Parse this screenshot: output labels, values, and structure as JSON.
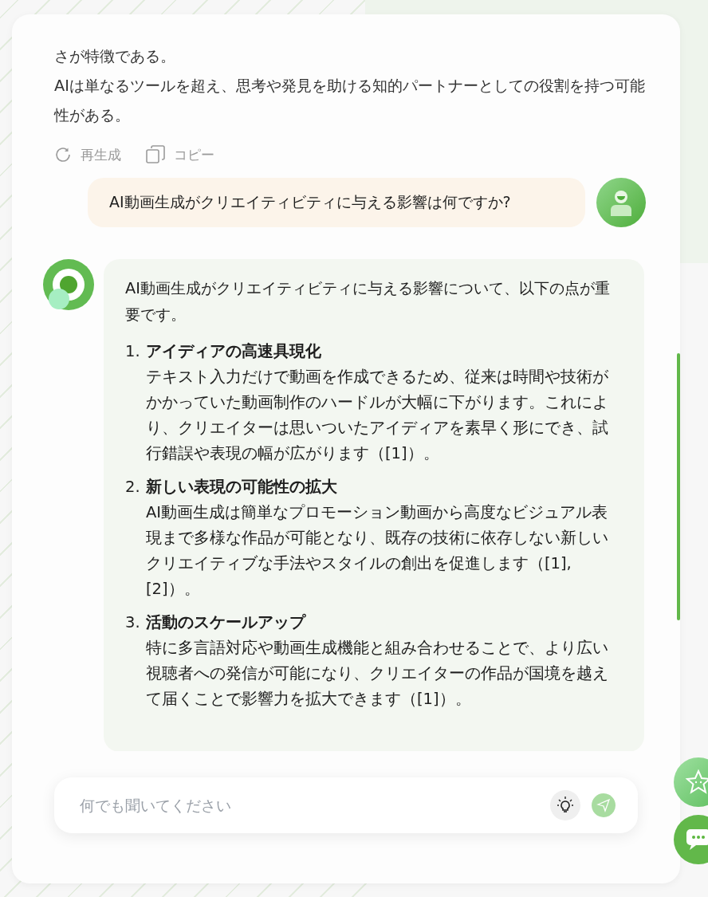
{
  "previous_message": {
    "paragraphs": [
      "さが特徴である。",
      "AIは単なるツールを超え、思考や発見を助ける知的パートナーとしての役割を持つ可能性がある。"
    ],
    "actions": [
      {
        "kind": "regenerate",
        "label": "再生成"
      },
      {
        "kind": "copy",
        "label": "コピー"
      }
    ]
  },
  "user_message": {
    "text": "AI動画生成がクリエイティビティに与える影響は何ですか?"
  },
  "answer": {
    "intro": "AI動画生成がクリエイティビティに与える影響について、以下の点が重要です。",
    "items": [
      {
        "number": "1.",
        "title": "アイディアの高速具現化",
        "body": "テキスト入力だけで動画を作成できるため、従来は時間や技術がかかっていた動画制作のハードルが大幅に下がります。これにより、クリエイターは思いついたアイディアを素早く形にでき、試行錯誤や表現の幅が広がります（[1]）。"
      },
      {
        "number": "2.",
        "title": "新しい表現の可能性の拡大",
        "body": "AI動画生成は簡単なプロモーション動画から高度なビジュアル表現まで多様な作品が可能となり、既存の技術に依存しない新しいクリエイティブな手法やスタイルの創出を促進します（[1], [2]）。"
      },
      {
        "number": "3.",
        "title": "活動のスケールアップ",
        "body": "特に多言語対応や動画生成機能と組み合わせることで、より広い視聴者への発信が可能になり、クリエイターの作品が国境を越えて届くことで影響力を拡大できます（[1]）。"
      }
    ]
  },
  "input": {
    "placeholder": "何でも聞いてください"
  }
}
